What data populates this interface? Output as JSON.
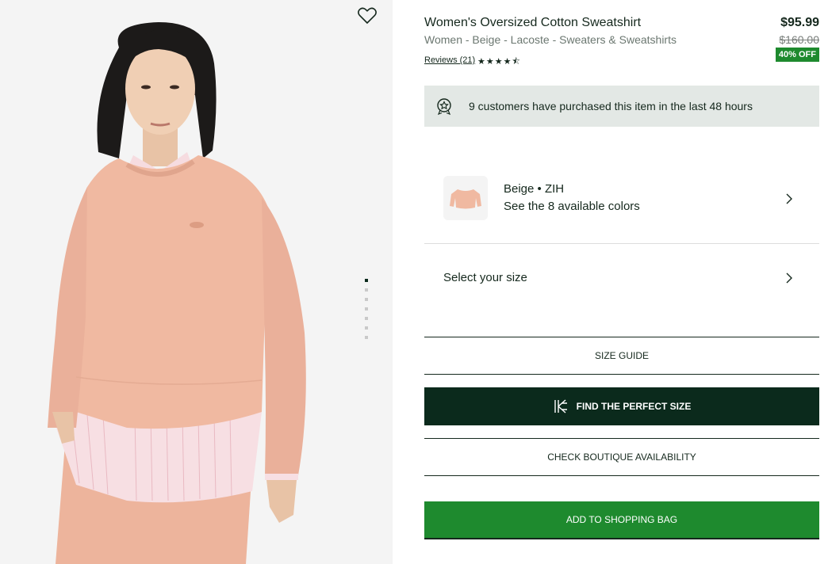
{
  "product": {
    "title": "Women's Oversized Cotton Sweatshirt",
    "breadcrumb": "Women - Beige - Lacoste - Sweaters & Sweatshirts",
    "reviews_label": "Reviews (21)",
    "rating": 4.5,
    "stars": "★★★★⯪",
    "price": "$95.99",
    "old_price": "$160.00",
    "discount": "40% OFF"
  },
  "notice": {
    "text": "9 customers have purchased this item in the last 48 hours",
    "icon": "badge-star-icon"
  },
  "color": {
    "name": "Beige • ZIH",
    "count_text": "See the 8 available colors"
  },
  "size": {
    "label": "Select your size"
  },
  "buttons": {
    "size_guide": "SIZE GUIDE",
    "find_size": "FIND THE PERFECT SIZE",
    "boutique": "CHECK BOUTIQUE AVAILABILITY",
    "add_bag": "ADD TO SHOPPING BAG"
  },
  "gallery": {
    "image_count": 7,
    "active_index": 0
  },
  "colors": {
    "brand_green": "#1e8a2e",
    "dark_green": "#0b2a1c",
    "sweater": "#f0b9a1"
  }
}
